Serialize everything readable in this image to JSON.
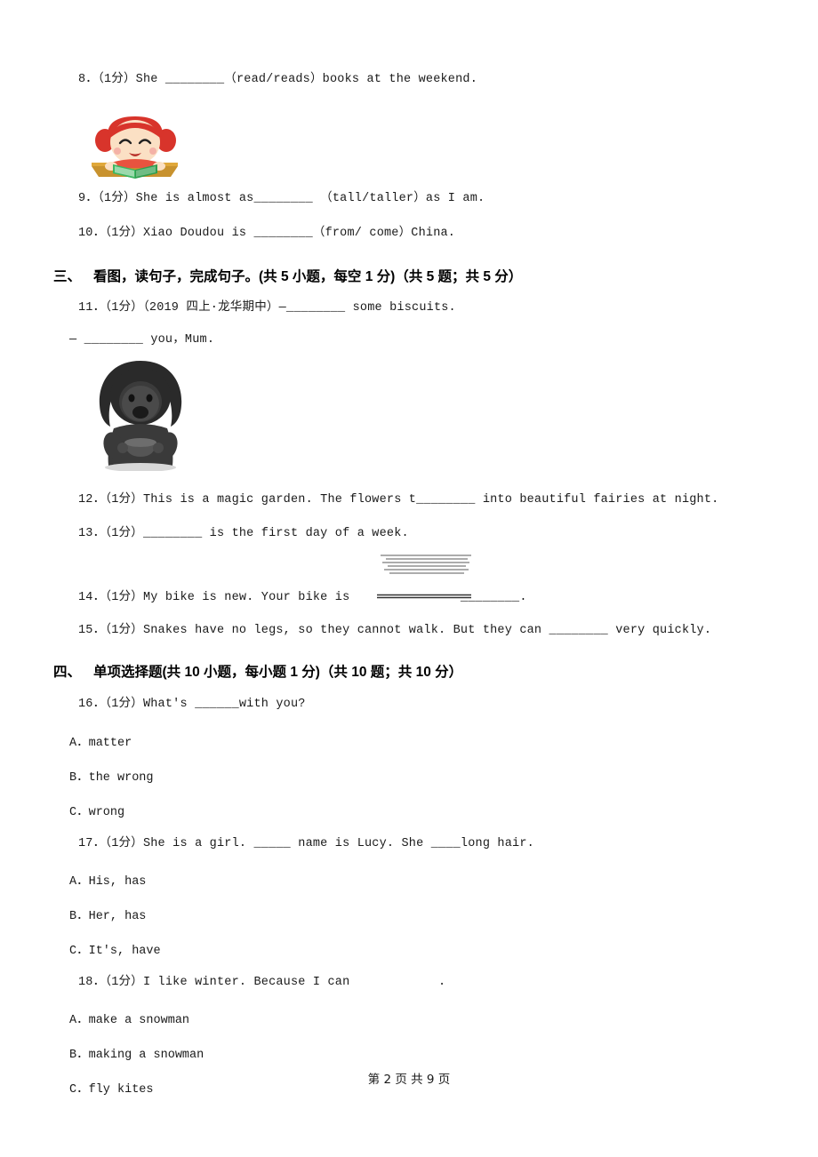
{
  "document": {
    "footer": "第 2 页 共 9 页",
    "questions_top": [
      {
        "id": "q8",
        "text": "8．（1分）She ________（read/reads）books at the weekend.",
        "has_image": true,
        "image_name": "girl-reading-book-illustration"
      },
      {
        "id": "q9",
        "text": "9．（1分）She is almost as________ （tall/taller）as I am."
      },
      {
        "id": "q10",
        "text": "10．（1分）Xiao Doudou is ________（from/ come）China."
      }
    ],
    "section_three": {
      "number": "三、",
      "title": "看图，读句子，完成句子。(共 5 小题，每空 1 分)（共 5 题；共 5 分）",
      "questions": [
        {
          "id": "q11",
          "line1": "11．（1分）（2019 四上·龙华期中）—________ some biscuits.",
          "line2": "— ________ you，Mum.",
          "has_image": true,
          "image_name": "child-with-bowl-illustration"
        },
        {
          "id": "q12",
          "text": "12．（1分）This is a magic garden. The flowers t________ into beautiful fairies at night."
        },
        {
          "id": "q13",
          "text": "13．（1分）________ is the first day of a week."
        },
        {
          "id": "q14",
          "text": "14．（1分）My bike is new. Your bike is               ________."
        },
        {
          "id": "q15",
          "text": "15．（1分）Snakes have no legs, so they cannot walk. But they can ________ very quickly."
        }
      ]
    },
    "section_four": {
      "number": "四、",
      "title": "单项选择题(共 10 小题，每小题 1 分)（共 10 题；共 10 分）",
      "questions": [
        {
          "id": "q16",
          "stem": "16．（1分）What's ______with you?",
          "options": [
            "A．matter",
            "B．the wrong",
            "C．wrong"
          ]
        },
        {
          "id": "q17",
          "stem": "17．（1分）She is a girl. _____ name is Lucy. She ____long hair.",
          "options": [
            "A．His, has",
            "B．Her, has",
            "C．It's, have"
          ]
        },
        {
          "id": "q18",
          "stem": "18．（1分）I like winter. Because I can            .",
          "options": [
            "A．make a snowman",
            "B．making a snowman",
            "C．fly kites"
          ]
        }
      ]
    }
  }
}
